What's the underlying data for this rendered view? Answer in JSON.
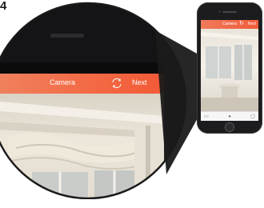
{
  "step_label": "4",
  "header": {
    "title": "Camera",
    "next_label": "Next",
    "refresh_icon": "refresh-icon"
  },
  "mini_phone": {
    "title": "Camera",
    "next_label": "Next"
  },
  "colors": {
    "header_start": "#f0805c",
    "header_end": "#f25a36",
    "device": "#1c1c1e"
  }
}
